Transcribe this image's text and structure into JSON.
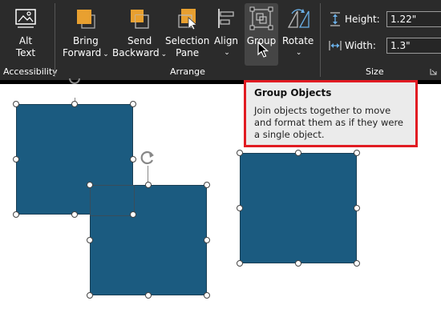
{
  "ribbon": {
    "accessibility": {
      "alt_text_line1": "Alt",
      "alt_text_line2": "Text",
      "group_label": "Accessibility"
    },
    "arrange": {
      "group_label": "Arrange",
      "bring_forward_line1": "Bring",
      "bring_forward_line2": "Forward",
      "send_backward_line1": "Send",
      "send_backward_line2": "Backward",
      "selection_pane_line1": "Selection",
      "selection_pane_line2": "Pane",
      "align": "Align",
      "group": "Group",
      "rotate": "Rotate",
      "caret": "⌄"
    },
    "size": {
      "group_label": "Size",
      "height_label": "Height:",
      "height_value": "1.22\"",
      "width_label": "Width:",
      "width_value": "1.3\""
    }
  },
  "tooltip": {
    "title": "Group Objects",
    "body": "Join objects together to move and format them as if they were a single object."
  },
  "colors": {
    "shape_fill": "#1b5b80",
    "accent_orange": "#e8a030",
    "tooltip_border": "#e11b22"
  }
}
